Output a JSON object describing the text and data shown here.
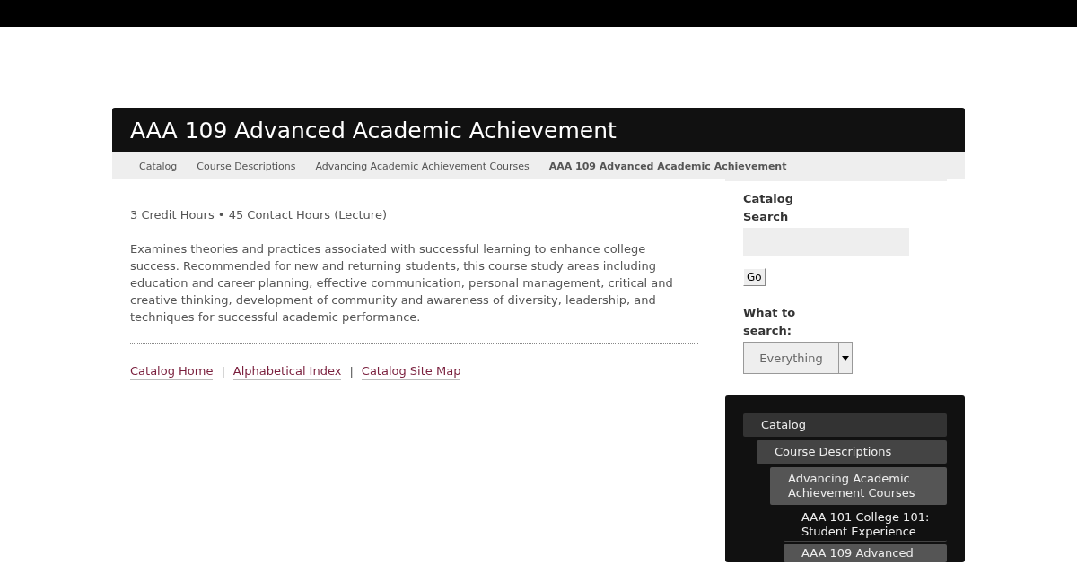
{
  "page_title": "AAA 109 Advanced Academic Achievement",
  "breadcrumbs": [
    {
      "label": "Catalog",
      "selected": false
    },
    {
      "label": "Course Descriptions",
      "selected": false
    },
    {
      "label": "Advancing Academic Achievement Courses",
      "selected": false
    },
    {
      "label": "AAA 109 Advanced Academic Achievement",
      "selected": true
    }
  ],
  "hours": "3 Credit Hours • 45 Contact Hours (Lecture)",
  "description": "Examines theories and practices associated with successful learning to enhance college success. Recommended for new and returning students, this course study areas including education and career planning, effective communication, personal management, critical and creative thinking, development of community and awareness of diversity, leadership, and techniques for successful academic performance.",
  "footer_links": [
    "Catalog Home",
    "Alphabetical Index",
    "Catalog Site Map"
  ],
  "footer_separator": "|",
  "search": {
    "label": "Catalog Search",
    "button": "Go",
    "scope_label": "What to search:",
    "scope_value": "Everything"
  },
  "nav_tree": [
    {
      "label": "Catalog",
      "expanded": true,
      "children": [
        {
          "label": "Course Descriptions",
          "expanded": true,
          "children": [
            {
              "label": "Advancing Academic Achievement Courses",
              "expanded": true,
              "children": [
                {
                  "label": "AAA 101 College 101: Student Experience",
                  "selected": false
                },
                {
                  "label": "AAA 109 Advanced",
                  "selected": true
                }
              ]
            }
          ]
        }
      ]
    }
  ]
}
